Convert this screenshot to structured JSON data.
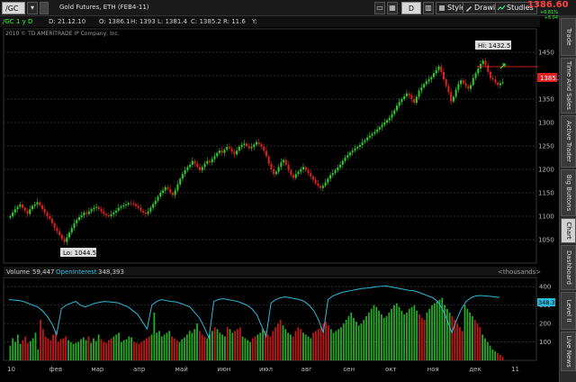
{
  "toolbar": {
    "symbol": "/GC",
    "description": "Gold Futures, ETH (FEB4-11)",
    "pct_change": "+0.81%",
    "net_change": "+8.04",
    "style_label": "Style",
    "drawings_label": "Drawings",
    "studies_label": "Studies",
    "last_price": "1386.60",
    "d_label": "D"
  },
  "infobar": {
    "aggregation": "/GC 1 y D",
    "date": "D: 21.12.10",
    "open": "O: 1386.1",
    "high": "H: 1393",
    "low": "L: 1381.4",
    "close": "C: 1385.2",
    "range": "R: 11.6",
    "y": "Y:"
  },
  "copyright": "2010 © TD AMERITRADE IP Company, Inc.",
  "annotations": {
    "high": "Hi: 1432.5",
    "low": "Lo: 1044.5",
    "price_tag": "1385.2"
  },
  "volume_header": {
    "volume_label": "Volume",
    "volume_value": "59,447",
    "oi_label": "OpenInterest",
    "oi_value": "348,393",
    "units": "<thousands>",
    "oi_tag": "348.39"
  },
  "price_axis": [
    "1450",
    "1400",
    "1350",
    "1300",
    "1250",
    "1200",
    "1150",
    "1100",
    "1050"
  ],
  "volume_axis": [
    "400",
    "300",
    "200",
    "100"
  ],
  "time_axis": [
    "10",
    "фев",
    "мар",
    "апр",
    "май",
    "июн",
    "июл",
    "авг",
    "сен",
    "окт",
    "ноя",
    "дек",
    "11"
  ],
  "side_tabs": [
    "Trade",
    "Time And Sales",
    "Active Trader",
    "Big Buttons",
    "Chart",
    "Dashboard",
    "Level II",
    "Live News"
  ],
  "active_tab": "Chart",
  "colors": {
    "up": "#2ecc2e",
    "down": "#e02020",
    "line": "#2fb8d8",
    "accent": "#ff4040"
  },
  "chart_data": {
    "type": "candlestick",
    "series": [
      {
        "name": "Price",
        "values": [
          1100,
          1108,
          1115,
          1120,
          1125,
          1118,
          1112,
          1105,
          1115,
          1122,
          1125,
          1130,
          1123,
          1115,
          1108,
          1100,
          1095,
          1085,
          1075,
          1068,
          1060,
          1052,
          1045,
          1055,
          1065,
          1075,
          1085,
          1092,
          1098,
          1102,
          1108,
          1105,
          1110,
          1115,
          1118,
          1120,
          1115,
          1110,
          1105,
          1102,
          1100,
          1104,
          1108,
          1112,
          1118,
          1121,
          1123,
          1125,
          1128,
          1127,
          1126,
          1122,
          1118,
          1112,
          1108,
          1105,
          1110,
          1118,
          1126,
          1133,
          1142,
          1150,
          1155,
          1162,
          1158,
          1150,
          1145,
          1155,
          1168,
          1180,
          1190,
          1198,
          1205,
          1210,
          1218,
          1212,
          1205,
          1198,
          1205,
          1212,
          1218,
          1215,
          1222,
          1228,
          1235,
          1240,
          1235,
          1242,
          1248,
          1245,
          1238,
          1232,
          1240,
          1248,
          1252,
          1255,
          1250,
          1245,
          1248,
          1253,
          1258,
          1254,
          1248,
          1240,
          1228,
          1212,
          1200,
          1190,
          1195,
          1205,
          1215,
          1220,
          1210,
          1198,
          1188,
          1182,
          1190,
          1195,
          1200,
          1205,
          1198,
          1192,
          1185,
          1178,
          1170,
          1165,
          1160,
          1165,
          1172,
          1180,
          1188,
          1192,
          1198,
          1204,
          1210,
          1218,
          1225,
          1230,
          1236,
          1240,
          1245,
          1248,
          1252,
          1258,
          1262,
          1268,
          1272,
          1276,
          1280,
          1285,
          1290,
          1295,
          1300,
          1305,
          1310,
          1318,
          1326,
          1336,
          1344,
          1350,
          1356,
          1362,
          1358,
          1350,
          1342,
          1355,
          1368,
          1375,
          1382,
          1388,
          1392,
          1397,
          1405,
          1412,
          1420,
          1408,
          1392,
          1378,
          1365,
          1345,
          1355,
          1370,
          1382,
          1390,
          1384,
          1378,
          1372,
          1380,
          1395,
          1405,
          1415,
          1425,
          1432,
          1422,
          1408,
          1395,
          1392,
          1385,
          1380,
          1384,
          1386
        ]
      }
    ],
    "volume": [
      80,
      120,
      100,
      140,
      90,
      110,
      130,
      95,
      105,
      120,
      150,
      60,
      220,
      170,
      130,
      120,
      110,
      140,
      160,
      100,
      115,
      120,
      130,
      110,
      100,
      90,
      95,
      100,
      115,
      125,
      110,
      130,
      95,
      120,
      105,
      140,
      115,
      100,
      95,
      110,
      120,
      130,
      140,
      150,
      100,
      110,
      115,
      130,
      125,
      100,
      95,
      90,
      100,
      110,
      120,
      130,
      140,
      260,
      150,
      160,
      130,
      140,
      150,
      160,
      130,
      120,
      110,
      100,
      115,
      125,
      140,
      160,
      150,
      170,
      200,
      160,
      140,
      130,
      120,
      140,
      160,
      180,
      170,
      150,
      140,
      130,
      180,
      170,
      150,
      160,
      170,
      180,
      130,
      120,
      110,
      100,
      120,
      130,
      140,
      150,
      170,
      160,
      140,
      130,
      160,
      180,
      200,
      220,
      190,
      170,
      150,
      140,
      130,
      160,
      180,
      170,
      150,
      140,
      130,
      120,
      150,
      160,
      170,
      180,
      200,
      210,
      190,
      170,
      150,
      160,
      170,
      180,
      200,
      220,
      240,
      260,
      230,
      210,
      190,
      200,
      220,
      240,
      260,
      280,
      300,
      290,
      270,
      250,
      230,
      240,
      260,
      280,
      300,
      310,
      290,
      270,
      250,
      260,
      280,
      290,
      300,
      270,
      250,
      230,
      220,
      260,
      280,
      300,
      310,
      320,
      330,
      340,
      300,
      280,
      260,
      240,
      220,
      200,
      180,
      160,
      300,
      280,
      260,
      240,
      220,
      200,
      180,
      140,
      120,
      100,
      80,
      60,
      50,
      40,
      30,
      20
    ],
    "open_interest": [
      330,
      328,
      325,
      320,
      310,
      300,
      290,
      270,
      240,
      200,
      140,
      280,
      300,
      310,
      320,
      300,
      290,
      300,
      310,
      315,
      320,
      318,
      315,
      312,
      300,
      290,
      270,
      250,
      210,
      170,
      300,
      320,
      330,
      325,
      320,
      318,
      310,
      300,
      290,
      260,
      230,
      180,
      120,
      320,
      330,
      335,
      330,
      325,
      320,
      310,
      300,
      280,
      250,
      190,
      130,
      310,
      330,
      340,
      345,
      340,
      335,
      330,
      320,
      300,
      270,
      220,
      150,
      330,
      350,
      360,
      370,
      375,
      380,
      385,
      390,
      392,
      395,
      400,
      402,
      405,
      400,
      395,
      390,
      385,
      380,
      378,
      370,
      360,
      350,
      340,
      320,
      280,
      220,
      150,
      220,
      280,
      320,
      340,
      350,
      352,
      350,
      348,
      345,
      342
    ],
    "ylim": [
      1000,
      1500
    ],
    "volume_ylim": [
      0,
      450
    ]
  }
}
